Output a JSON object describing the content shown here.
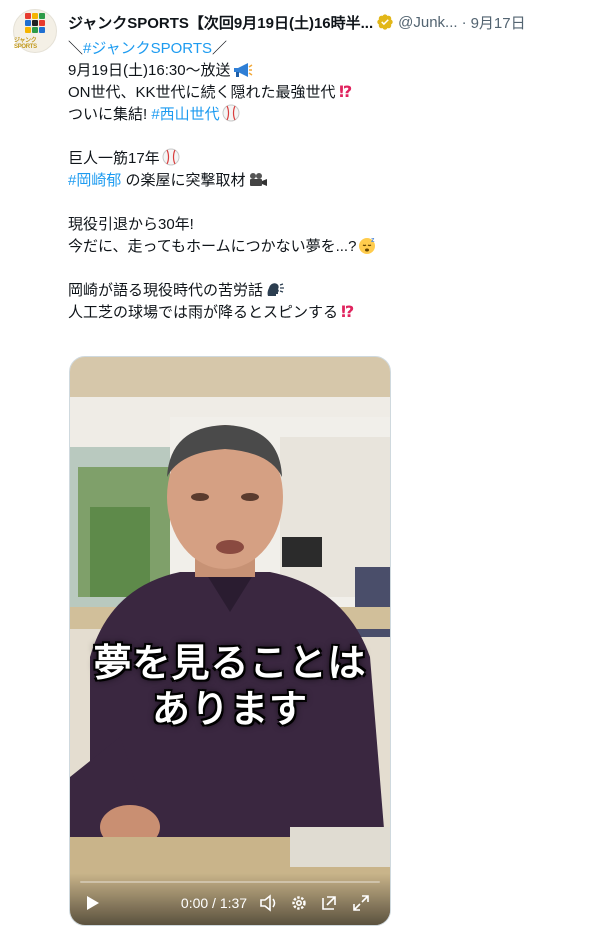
{
  "author": {
    "display_name": "ジャンクSPORTS【次回9月19日(土)16時半...",
    "handle": "@Junk...",
    "separator": "·",
    "date": "9月17日",
    "avatar_text": "ジャンクSPORTS"
  },
  "tweet": {
    "lines": [
      {
        "pre": "＼",
        "link": "#ジャンクSPORTS",
        "post": "／"
      },
      {
        "text": "9月19日(土)16:30～放送",
        "emoji": "megaphone-icon"
      },
      {
        "text": "ON世代、KK世代に続く隠れた最強世代",
        "emoji": "exclamation-question-icon"
      },
      {
        "text": "ついに集結! ",
        "link": "#西山世代",
        "emoji": "baseball-icon"
      },
      {
        "blank": true
      },
      {
        "text": "巨人一筋17年",
        "emoji": "baseball-icon"
      },
      {
        "link": "#岡崎郁",
        "post": " の楽屋に突撃取材",
        "emoji": "movie-camera-icon"
      },
      {
        "blank": true
      },
      {
        "text": "現役引退から30年!"
      },
      {
        "text": "今だに、走ってもホームにつかない夢を...?",
        "emoji": "sleeping-face-icon"
      },
      {
        "blank": true
      },
      {
        "text": "岡崎が語る現役時代の苦労話",
        "emoji": "speaking-head-icon"
      },
      {
        "text": "人工芝の球場では雨が降るとスピンする",
        "emoji": "exclamation-question-icon"
      }
    ]
  },
  "video": {
    "caption_line1": "夢を見ることは",
    "caption_line2": "あります",
    "time": "0:00 / 1:37",
    "progress": 0
  }
}
